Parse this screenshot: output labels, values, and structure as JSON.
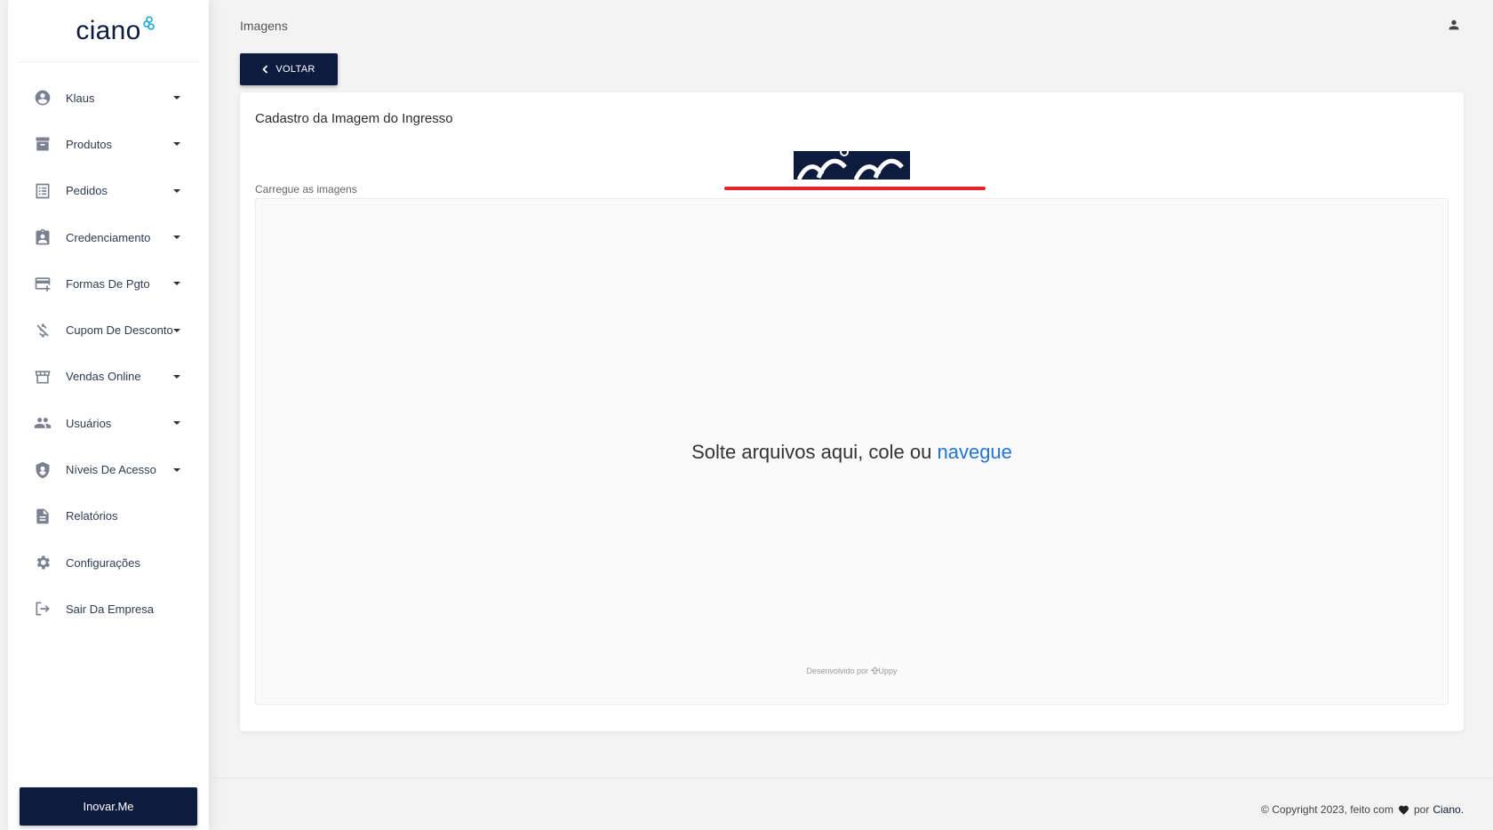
{
  "brand": {
    "logo_text": "ciano"
  },
  "sidebar": {
    "items": [
      {
        "label": "Klaus",
        "icon": "account-circle-icon",
        "has_caret": true
      },
      {
        "label": "Produtos",
        "icon": "archive-icon",
        "has_caret": true
      },
      {
        "label": "Pedidos",
        "icon": "list-icon",
        "has_caret": true
      },
      {
        "label": "Credenciamento",
        "icon": "badge-icon",
        "has_caret": true
      },
      {
        "label": "Formas De Pgto",
        "icon": "card-add-icon",
        "has_caret": true
      },
      {
        "label": "Cupom De Desconto",
        "icon": "money-off-icon",
        "has_caret": true
      },
      {
        "label": "Vendas Online",
        "icon": "storefront-icon",
        "has_caret": true
      },
      {
        "label": "Usuários",
        "icon": "people-icon",
        "has_caret": true
      },
      {
        "label": "Níveis De Acesso",
        "icon": "shield-icon",
        "has_caret": true
      },
      {
        "label": "Relatórios",
        "icon": "document-icon",
        "has_caret": false
      },
      {
        "label": "Configurações",
        "icon": "gear-icon",
        "has_caret": false
      },
      {
        "label": "Sair Da Empresa",
        "icon": "logout-icon",
        "has_caret": false
      }
    ],
    "footer_button": "Inovar.Me"
  },
  "header": {
    "breadcrumb": "Imagens"
  },
  "toolbar": {
    "back_label": "VOLTAR"
  },
  "card": {
    "title": "Cadastro da Imagem do Ingresso",
    "upload_label": "Carregue as imagens",
    "dropzone": {
      "text_prefix": "Solte arquivos aqui, cole ou ",
      "browse_link": "navegue",
      "powered_by": "Desenvolvido por",
      "powered_brand": "Uppy"
    }
  },
  "footer": {
    "copyright": "© Copyright 2023, feito com",
    "by": "por",
    "brand": "Ciano."
  },
  "colors": {
    "primary": "#0d1b3e",
    "accent_red": "#e5232a",
    "link": "#2275d7",
    "logo_mark": "#1aa6d8"
  }
}
